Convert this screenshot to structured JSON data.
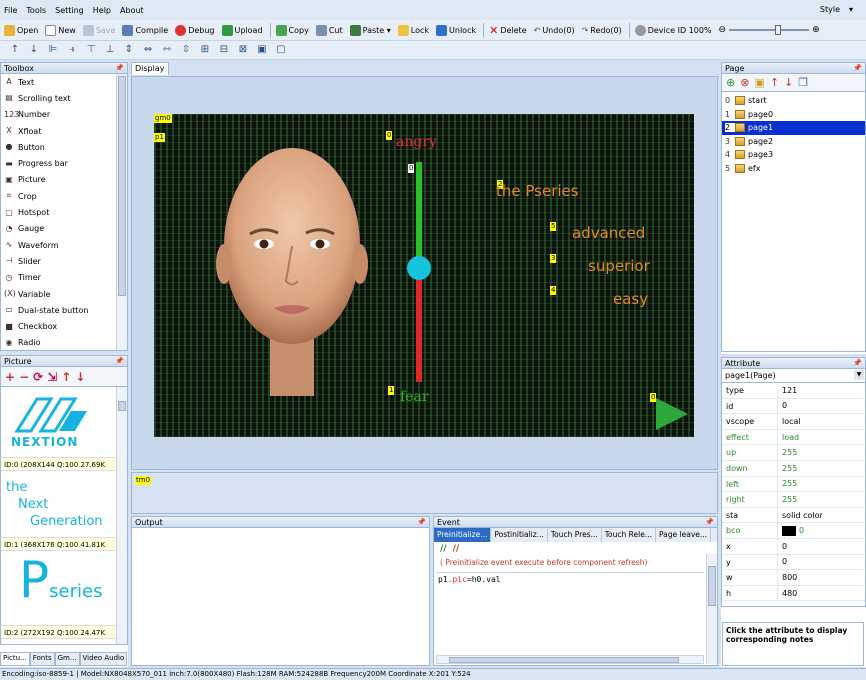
{
  "menu": {
    "file": "File",
    "tools": "Tools",
    "setting": "Setting",
    "help": "Help",
    "about": "About",
    "style": "Style"
  },
  "toolbar": {
    "open": "Open",
    "new": "New",
    "save": "Save",
    "compile": "Compile",
    "debug": "Debug",
    "upload": "Upload",
    "copy": "Copy",
    "cut": "Cut",
    "paste": "Paste",
    "lock": "Lock",
    "unlock": "Unlock",
    "delete": "Delete",
    "undo": "Undo(0)",
    "redo": "Redo(0)",
    "device_id": "Device ID",
    "zoom": "100%"
  },
  "toolbox": {
    "title": "Toolbox",
    "items": [
      "Text",
      "Scrolling text",
      "Number",
      "Xfloat",
      "Button",
      "Progress bar",
      "Picture",
      "Crop",
      "Hotspot",
      "Gauge",
      "Waveform",
      "Slider",
      "Timer",
      "Variable",
      "Dual-state button",
      "Checkbox",
      "Radio"
    ],
    "icons": [
      "A",
      "▤",
      "123",
      "X",
      "●",
      "▬",
      "▣",
      "⌗",
      "▢",
      "◔",
      "∿",
      "⊣",
      "◷",
      "(X)",
      "▭",
      "■",
      "◉"
    ]
  },
  "picture_panel": {
    "title": "Picture",
    "items": [
      {
        "caption": "ID:0 (208X144 Q:100 27.69K"
      },
      {
        "caption": "ID:1 (368X176 Q:100 41.81K"
      },
      {
        "caption": "ID:2 (272X192 Q:100 24.47K"
      }
    ],
    "logo_text": "NEXTION",
    "slogan": [
      "the",
      "Next",
      "Generation"
    ],
    "pseries": "series"
  },
  "bottom_tabs": [
    "Pictu...",
    "Fonts",
    "Gm...",
    "Video Audio"
  ],
  "display": {
    "tab": "Display",
    "tags": {
      "gm0": "gm0",
      "p1": "p1",
      "t0": "0",
      "t1": "1",
      "t2": "2",
      "t3": "3",
      "t4": "4",
      "t5": "5",
      "slider_top": "0",
      "b0": "0"
    },
    "angry": "angry",
    "fear": "fear",
    "brand": "the Pseries",
    "words": [
      "advanced",
      "superior",
      "easy"
    ],
    "timeline_tag": "tm0"
  },
  "output": {
    "title": "Output"
  },
  "event": {
    "title": "Event",
    "tabs": [
      "Preinitialize...",
      "Postinitializ...",
      "Touch Pres...",
      "Touch Rele...",
      "Page leave..."
    ],
    "hint": "( Preinitialize event execute before component refresh)",
    "code_var": "p1",
    "code_prop": ".pic",
    "code_rest": "=h0.val"
  },
  "page_panel": {
    "title": "Page",
    "items": [
      {
        "n": "0",
        "name": "start"
      },
      {
        "n": "1",
        "name": "page0"
      },
      {
        "n": "2",
        "name": "page1",
        "selected": true
      },
      {
        "n": "3",
        "name": "page2"
      },
      {
        "n": "4",
        "name": "page3"
      },
      {
        "n": "5",
        "name": "efx"
      }
    ]
  },
  "attribute": {
    "title": "Attribute",
    "selector": "page1(Page)",
    "rows": [
      {
        "k": "type",
        "v": "121"
      },
      {
        "k": "id",
        "v": "0"
      },
      {
        "k": "vscope",
        "v": "local"
      },
      {
        "k": "effect",
        "v": "load",
        "green": true
      },
      {
        "k": "up",
        "v": "255",
        "green": true
      },
      {
        "k": "down",
        "v": "255",
        "green": true
      },
      {
        "k": "left",
        "v": "255",
        "green": true
      },
      {
        "k": "right",
        "v": "255",
        "green": true
      },
      {
        "k": "sta",
        "v": "solid color"
      },
      {
        "k": "bco",
        "v": "0",
        "swatch": "#000000",
        "green": true
      },
      {
        "k": "x",
        "v": "0"
      },
      {
        "k": "y",
        "v": "0"
      },
      {
        "k": "w",
        "v": "800"
      },
      {
        "k": "h",
        "v": "480"
      }
    ],
    "note": "Click the attribute to display corresponding notes"
  },
  "status": "Encoding:iso-8859-1 | Model:NX8048X570_011 inch:7.0(800X480) Flash:128M RAM:524288B Frequency200M      Coordinate X:201  Y:524"
}
